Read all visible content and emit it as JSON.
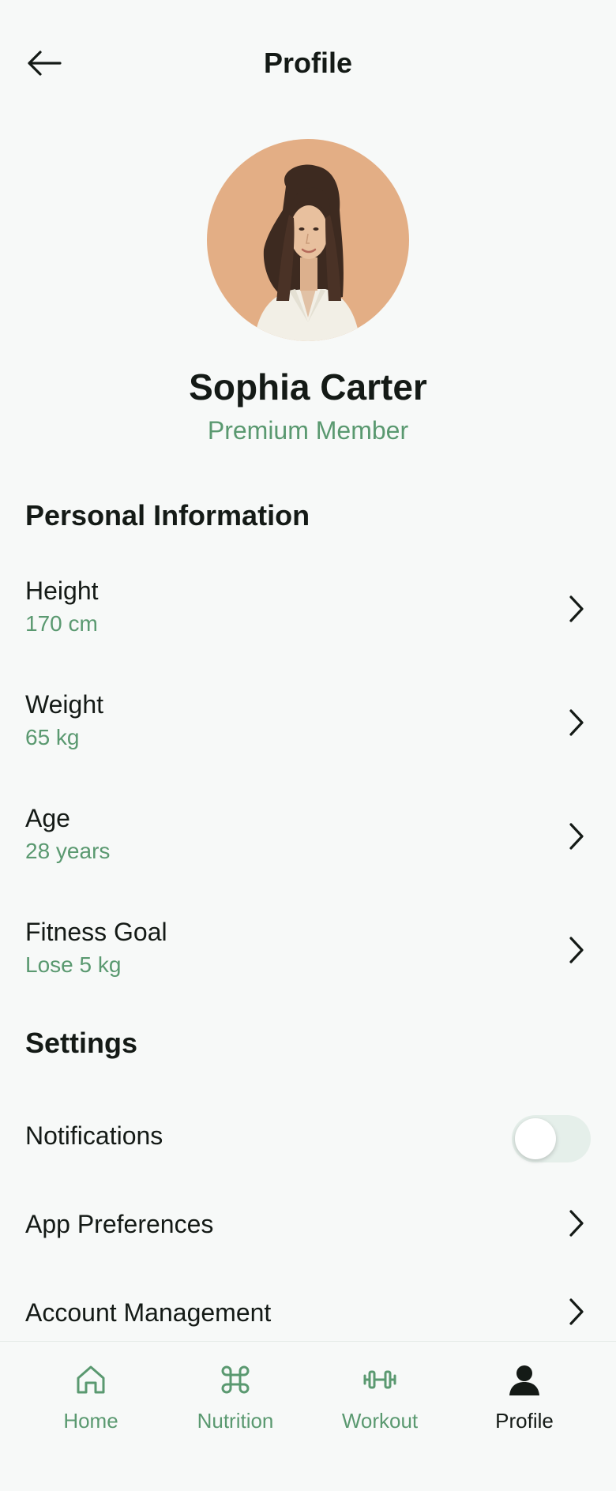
{
  "header": {
    "title": "Profile"
  },
  "user": {
    "name": "Sophia Carter",
    "tier": "Premium Member"
  },
  "personal": {
    "title": "Personal Information",
    "items": [
      {
        "label": "Height",
        "value": "170 cm"
      },
      {
        "label": "Weight",
        "value": "65 kg"
      },
      {
        "label": "Age",
        "value": "28 years"
      },
      {
        "label": "Fitness Goal",
        "value": "Lose 5 kg"
      }
    ]
  },
  "settings": {
    "title": "Settings",
    "notifications": {
      "label": "Notifications",
      "enabled": false
    },
    "app_preferences": "App Preferences",
    "account_management": "Account Management"
  },
  "nav": {
    "items": [
      {
        "label": "Home",
        "icon": "home-icon"
      },
      {
        "label": "Nutrition",
        "icon": "command-icon"
      },
      {
        "label": "Workout",
        "icon": "dumbbell-icon"
      },
      {
        "label": "Profile",
        "icon": "user-icon"
      }
    ],
    "active": "Profile"
  },
  "colors": {
    "accent": "#5a9970",
    "text": "#141a16",
    "background": "#f7f9f8",
    "avatar_bg": "#e3ae85",
    "toggle_track": "#e5efea"
  }
}
